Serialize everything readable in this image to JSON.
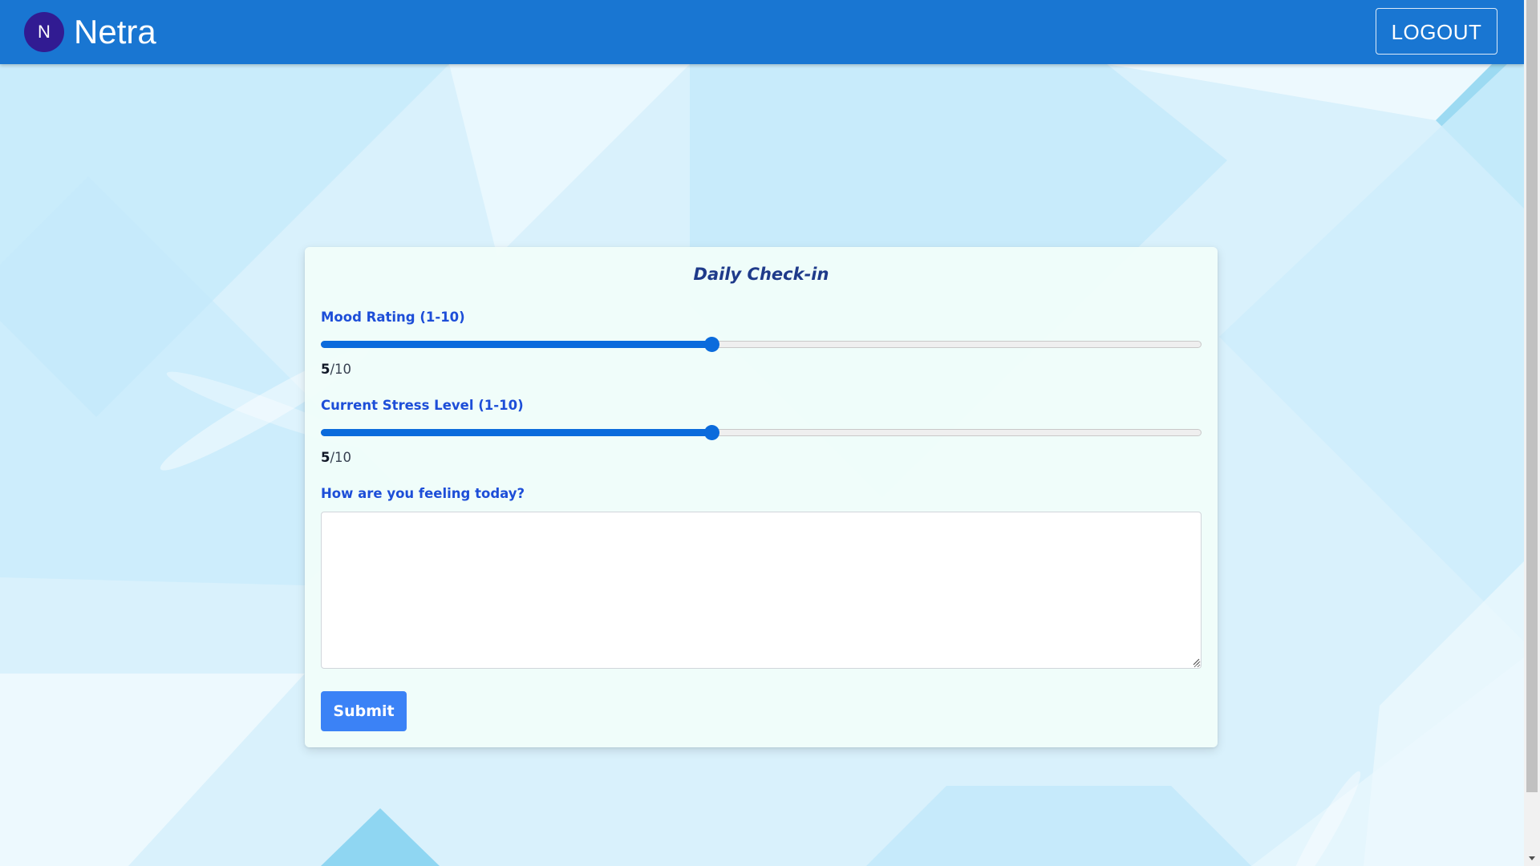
{
  "header": {
    "avatar_letter": "N",
    "brand": "Netra",
    "logout_label": "LOGOUT"
  },
  "checkin": {
    "title": "Daily Check-in",
    "mood": {
      "label": "Mood Rating (1-10)",
      "value": "5",
      "max_text": "/10",
      "fraction": 0.4444
    },
    "stress": {
      "label": "Current Stress Level (1-10)",
      "value": "5",
      "max_text": "/10",
      "fraction": 0.4444
    },
    "feelings": {
      "label": "How are you feeling today?",
      "value": ""
    },
    "submit_label": "Submit"
  },
  "colors": {
    "navbar": "#1976d2",
    "avatar": "#311b92",
    "accent": "#0b6bdc",
    "label": "#1d4ed8",
    "submit": "#3b82f6"
  }
}
